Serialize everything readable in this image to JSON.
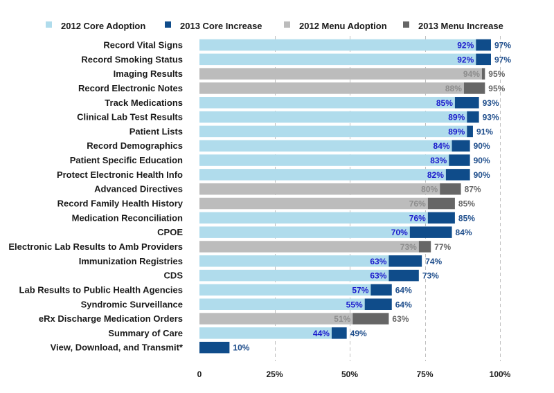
{
  "chart_data": {
    "type": "bar",
    "orientation": "horizontal",
    "stacked": true,
    "title": "",
    "xlabel": "",
    "ylabel": "",
    "xlim": [
      0,
      100
    ],
    "grid": true,
    "legend_position": "top",
    "x_ticks": [
      "0",
      "25%",
      "50%",
      "75%",
      "100%"
    ],
    "x_tick_values": [
      0,
      25,
      50,
      75,
      100
    ],
    "legend": [
      {
        "name": "2012 Core Adoption",
        "color": "#b0dcec"
      },
      {
        "name": "2013 Core Increase",
        "color": "#0f4c8a"
      },
      {
        "name": "2012 Menu Adoption",
        "color": "#bcbcbc"
      },
      {
        "name": "2013 Menu Increase",
        "color": "#666666"
      }
    ],
    "colors": {
      "core_base": "#b0dcec",
      "core_increase": "#0f4c8a",
      "menu_base": "#bcbcbc",
      "menu_increase": "#666666",
      "core_base_label": "#1a1acc",
      "core_total_label": "#1f4e8c",
      "menu_base_label": "#8c8c8c",
      "menu_total_label": "#666666",
      "gridline": "#bfbfbf"
    },
    "rows": [
      {
        "category": "Record Vital Signs",
        "kind": "core",
        "y2012": 92,
        "y2013": 97,
        "base_label": "92%",
        "total_label": "97%"
      },
      {
        "category": "Record Smoking Status",
        "kind": "core",
        "y2012": 92,
        "y2013": 97,
        "base_label": "92%",
        "total_label": "97%"
      },
      {
        "category": "Imaging Results",
        "kind": "menu",
        "y2012": 94,
        "y2013": 95,
        "base_label": "94%",
        "total_label": "95%"
      },
      {
        "category": "Record Electronic Notes ",
        "kind": "menu",
        "y2012": 88,
        "y2013": 95,
        "base_label": "88%",
        "total_label": "95%"
      },
      {
        "category": "Track Medications",
        "kind": "core",
        "y2012": 85,
        "y2013": 93,
        "base_label": "85%",
        "total_label": "93%"
      },
      {
        "category": "Clinical Lab Test Results",
        "kind": "core",
        "y2012": 89,
        "y2013": 93,
        "base_label": "89%",
        "total_label": "93%"
      },
      {
        "category": "Patient Lists",
        "kind": "core",
        "y2012": 89,
        "y2013": 91,
        "base_label": "89%",
        "total_label": "91%"
      },
      {
        "category": "Record Demographics",
        "kind": "core",
        "y2012": 84,
        "y2013": 90,
        "base_label": "84%",
        "total_label": "90%"
      },
      {
        "category": "Patient Specific Education",
        "kind": "core",
        "y2012": 83,
        "y2013": 90,
        "base_label": "83%",
        "total_label": "90%"
      },
      {
        "category": "Protect Electronic Health Info",
        "kind": "core",
        "y2012": 82,
        "y2013": 90,
        "base_label": "82%",
        "total_label": "90%"
      },
      {
        "category": "Advanced Directives",
        "kind": "menu",
        "y2012": 80,
        "y2013": 87,
        "base_label": "80%",
        "total_label": "87%"
      },
      {
        "category": "Record Family Health History",
        "kind": "menu",
        "y2012": 76,
        "y2013": 85,
        "base_label": "76%",
        "total_label": "85%"
      },
      {
        "category": "Medication Reconciliation",
        "kind": "core",
        "y2012": 76,
        "y2013": 85,
        "base_label": "76%",
        "total_label": "85%"
      },
      {
        "category": "CPOE",
        "kind": "core",
        "y2012": 70,
        "y2013": 84,
        "base_label": "70%",
        "total_label": "84%"
      },
      {
        "category": "Electronic Lab Results to Amb Providers",
        "kind": "menu",
        "y2012": 73,
        "y2013": 77,
        "base_label": "73%",
        "total_label": "77%"
      },
      {
        "category": "Immunization Registries",
        "kind": "core",
        "y2012": 63,
        "y2013": 74,
        "base_label": "63%",
        "total_label": "74%"
      },
      {
        "category": "CDS",
        "kind": "core",
        "y2012": 63,
        "y2013": 73,
        "base_label": "63%",
        "total_label": "73%"
      },
      {
        "category": "Lab Results to Public Health Agencies",
        "kind": "core",
        "y2012": 57,
        "y2013": 64,
        "base_label": "57%",
        "total_label": "64%"
      },
      {
        "category": "Syndromic Surveillance",
        "kind": "core",
        "y2012": 55,
        "y2013": 64,
        "base_label": "55%",
        "total_label": "64%"
      },
      {
        "category": "eRx Discharge Medication Orders",
        "kind": "menu",
        "y2012": 51,
        "y2013": 63,
        "base_label": "51%",
        "total_label": "63%"
      },
      {
        "category": "Summary of Care",
        "kind": "core",
        "y2012": 44,
        "y2013": 49,
        "base_label": "44%",
        "total_label": "49%"
      },
      {
        "category": "View, Download, and Transmit*",
        "kind": "core",
        "y2012": 0,
        "y2013": 10,
        "base_label": "",
        "total_label": "10%"
      }
    ]
  }
}
